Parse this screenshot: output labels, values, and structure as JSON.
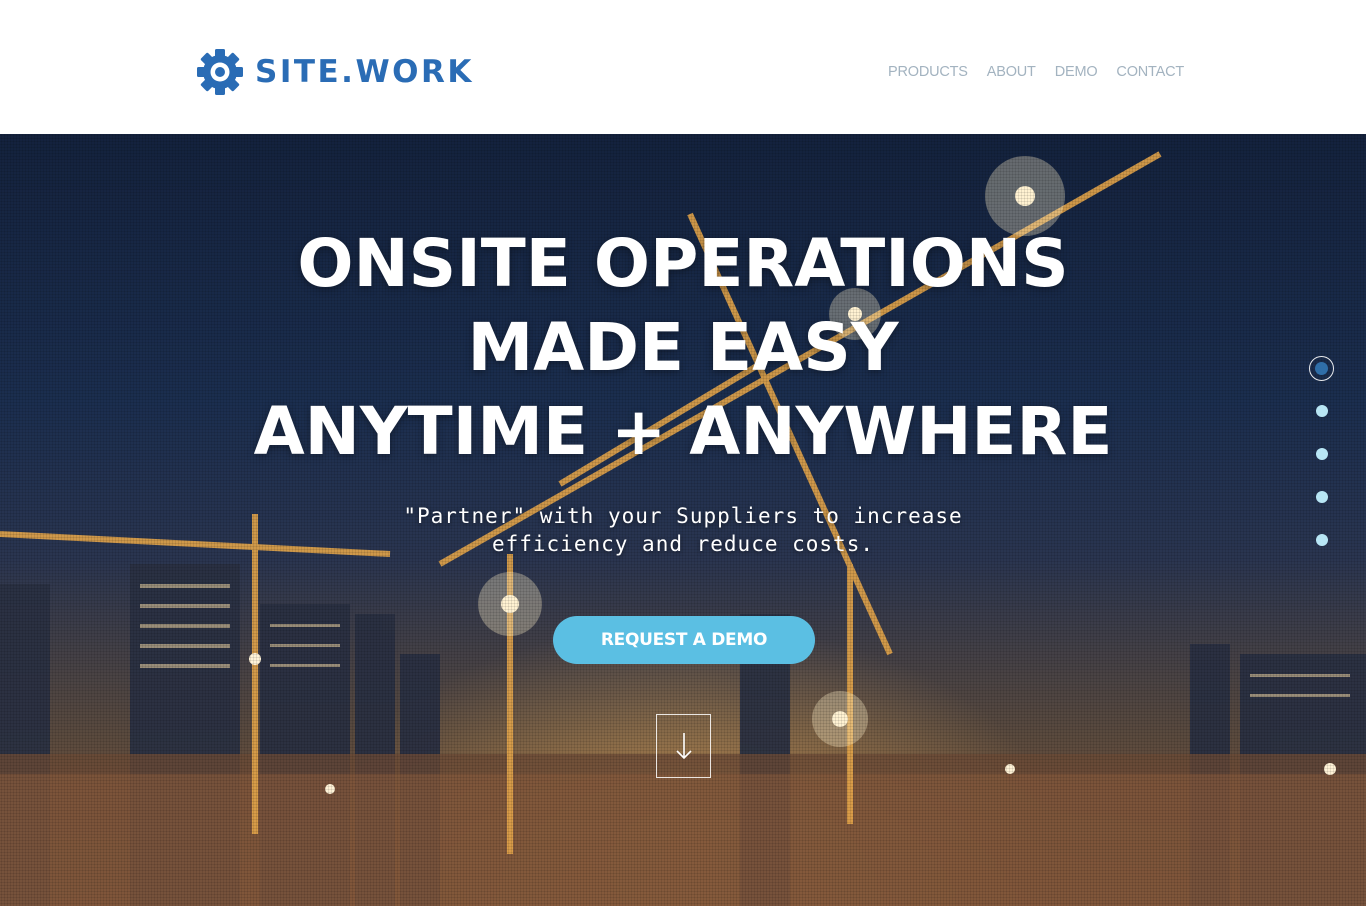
{
  "brand": {
    "logo_icon": "gear-icon",
    "name": "SITE.WORK",
    "color": "#2a6cb5"
  },
  "nav": {
    "items": [
      {
        "label": "PRODUCTS"
      },
      {
        "label": "ABOUT"
      },
      {
        "label": "DEMO"
      },
      {
        "label": "CONTACT"
      }
    ],
    "color": "#a3b3c0"
  },
  "hero": {
    "headline": [
      "ONSITE OPERATIONS",
      "MADE EASY",
      "ANYTIME + ANYWHERE"
    ],
    "subline": [
      "\"Partner\" with your Suppliers to increase",
      "efficiency and reduce costs."
    ],
    "cta_label": "REQUEST A DEMO",
    "cta_color": "#5bbfe3",
    "scroll_icon": "arrow-down-icon"
  },
  "slide_nav": {
    "count": 5,
    "active_index": 0,
    "active_color": "#2f6ea8",
    "inactive_color": "#b8e6f5"
  }
}
